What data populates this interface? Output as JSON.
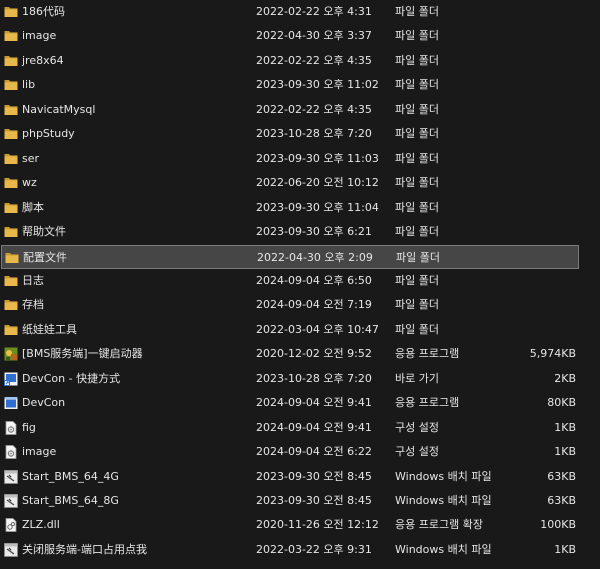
{
  "rows": [
    {
      "name": "186代码",
      "date": "2022-02-22 오후 4:31",
      "type": "파일 폴더",
      "size": "",
      "icon": "folder-icon"
    },
    {
      "name": "image",
      "date": "2022-04-30 오후 3:37",
      "type": "파일 폴더",
      "size": "",
      "icon": "folder-icon"
    },
    {
      "name": "jre8x64",
      "date": "2022-02-22 오후 4:35",
      "type": "파일 폴더",
      "size": "",
      "icon": "folder-icon"
    },
    {
      "name": "lib",
      "date": "2023-09-30 오후 11:02",
      "type": "파일 폴더",
      "size": "",
      "icon": "folder-icon"
    },
    {
      "name": "NavicatMysql",
      "date": "2022-02-22 오후 4:35",
      "type": "파일 폴더",
      "size": "",
      "icon": "folder-icon"
    },
    {
      "name": "phpStudy",
      "date": "2023-10-28 오후 7:20",
      "type": "파일 폴더",
      "size": "",
      "icon": "folder-icon"
    },
    {
      "name": "ser",
      "date": "2023-09-30 오후 11:03",
      "type": "파일 폴더",
      "size": "",
      "icon": "folder-icon"
    },
    {
      "name": "wz",
      "date": "2022-06-20 오전 10:12",
      "type": "파일 폴더",
      "size": "",
      "icon": "folder-icon"
    },
    {
      "name": "脚本",
      "date": "2023-09-30 오후 11:04",
      "type": "파일 폴더",
      "size": "",
      "icon": "folder-icon"
    },
    {
      "name": "帮助文件",
      "date": "2023-09-30 오후 6:21",
      "type": "파일 폴더",
      "size": "",
      "icon": "folder-icon"
    },
    {
      "name": "配置文件",
      "date": "2022-04-30 오후 2:09",
      "type": "파일 폴더",
      "size": "",
      "icon": "folder-icon",
      "selected": true
    },
    {
      "name": "日志",
      "date": "2024-09-04 오후 6:50",
      "type": "파일 폴더",
      "size": "",
      "icon": "folder-icon"
    },
    {
      "name": "存档",
      "date": "2024-09-04 오전 7:19",
      "type": "파일 폴더",
      "size": "",
      "icon": "folder-icon"
    },
    {
      "name": "纸娃娃工具",
      "date": "2022-03-04 오후 10:47",
      "type": "파일 폴더",
      "size": "",
      "icon": "folder-icon"
    },
    {
      "name": "[BMS服务端]一键启动器",
      "date": "2020-12-02 오전 9:52",
      "type": "응용 프로그램",
      "size": "5,974KB",
      "icon": "launcher-app-icon"
    },
    {
      "name": "DevCon - 快捷方式",
      "date": "2023-10-28 오후 7:20",
      "type": "바로 가기",
      "size": "2KB",
      "icon": "shortcut-icon"
    },
    {
      "name": "DevCon",
      "date": "2024-09-04 오전 9:41",
      "type": "응용 프로그램",
      "size": "80KB",
      "icon": "app-icon"
    },
    {
      "name": "fig",
      "date": "2024-09-04 오전 9:41",
      "type": "구성 설정",
      "size": "1KB",
      "icon": "config-file-icon"
    },
    {
      "name": "image",
      "date": "2024-09-04 오전 6:22",
      "type": "구성 설정",
      "size": "1KB",
      "icon": "config-file-icon"
    },
    {
      "name": "Start_BMS_64_4G",
      "date": "2023-09-30 오전 8:45",
      "type": "Windows 배치 파일",
      "size": "63KB",
      "icon": "batch-file-icon"
    },
    {
      "name": "Start_BMS_64_8G",
      "date": "2023-09-30 오전 8:45",
      "type": "Windows 배치 파일",
      "size": "63KB",
      "icon": "batch-file-icon"
    },
    {
      "name": "ZLZ.dll",
      "date": "2020-11-26 오전 12:12",
      "type": "응용 프로그램 확장",
      "size": "100KB",
      "icon": "dll-file-icon"
    },
    {
      "name": "关闭服务端-端口占用点我",
      "date": "2022-03-22 오후 9:31",
      "type": "Windows 배치 파일",
      "size": "1KB",
      "icon": "batch-file-icon"
    }
  ],
  "colors": {
    "background": "#191919",
    "text": "#e6e6e6",
    "folder": "#e8b84a",
    "selected_bg": "#464646",
    "selected_border": "#7a7a7a"
  }
}
